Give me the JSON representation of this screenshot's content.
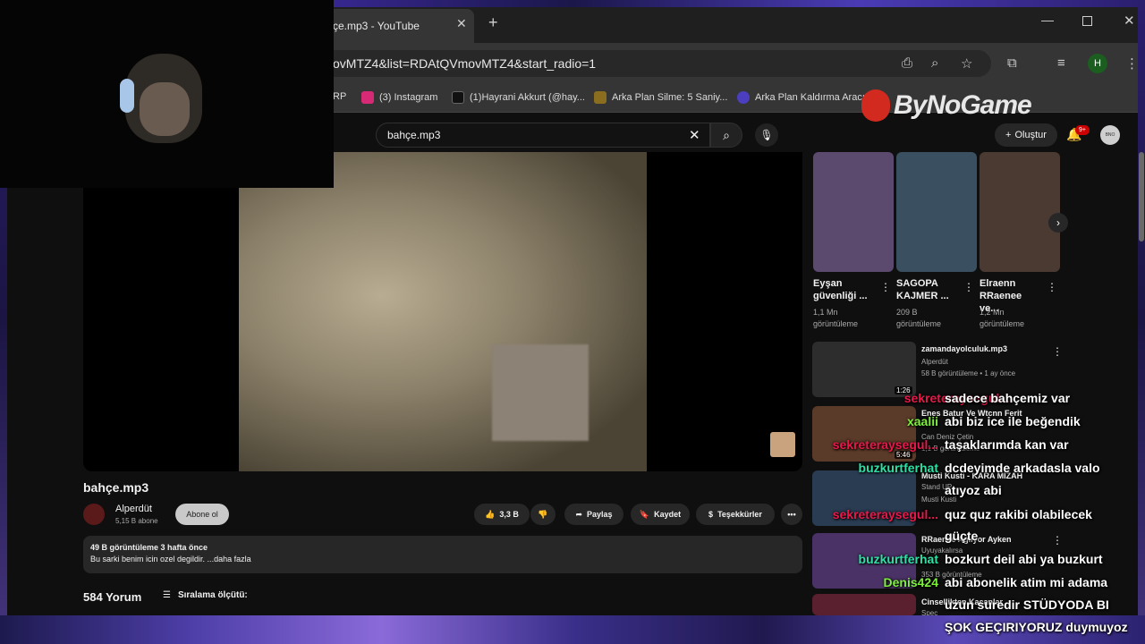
{
  "browser": {
    "tab_title": "çe.mp3 - YouTube",
    "url": "ovMTZ4&list=RDAtQVmovMTZ4&start_radio=1",
    "bookmarks": [
      {
        "label": "RP",
        "color": "#444444"
      },
      {
        "label": "(3) Instagram",
        "color": "#d62976"
      },
      {
        "label": "(1)Hayrani Akkurt (@hay...",
        "color": "#111111"
      },
      {
        "label": "Arka Plan Silme: 5 Saniy...",
        "color": "#8a6d1e"
      },
      {
        "label": "Arka Plan Kaldırma Aracı...",
        "color": "#4b3fbf"
      }
    ],
    "profile_initial": "H"
  },
  "overlay": {
    "logo_text": "ByNoGame"
  },
  "youtube": {
    "search_value": "bahçe.mp3",
    "create_label": "Oluştur",
    "notification_count": "9+",
    "channel_avatar_text": "BNO"
  },
  "video": {
    "title": "bahçe.mp3",
    "channel_name": "Alperdüt",
    "subscribers": "5,15 B abone",
    "subscribe_label": "Abone ol",
    "likes": "3,3 B",
    "share_label": "Paylaş",
    "save_label": "Kaydet",
    "thanks_label": "Teşekkürler",
    "more_label": "•••",
    "stats": "49 B görüntüleme  3 hafta önce",
    "description": "Bu sarki benim icin ozel degildir. ...daha fazla",
    "comment_count": "584 Yorum",
    "sort_label": "Sıralama ölçütü:"
  },
  "shorts": [
    {
      "title": "Eyşan güvenliği ...",
      "views": "1,1 Mn görüntüleme",
      "color": "#5b4a6e"
    },
    {
      "title": "SAGOPA KAJMER ...",
      "views": "209 B görüntüleme",
      "color": "#3a4f60"
    },
    {
      "title": "Elraenn RRaenee ve...",
      "views": "1,2 Mn görüntüleme",
      "color": "#4a3a32"
    }
  ],
  "recommendations": [
    {
      "title": "zamandayolculuk.mp3",
      "channel": "Alperdüt",
      "meta": "58 B görüntüleme • 1 ay önce",
      "duration": "1:26",
      "color": "#2d2d2d"
    },
    {
      "title": "Enes Batur Ve Wtcnn Ferit",
      "channel": "Can Deniz Çetin",
      "meta": "1,1 B görüntüleme",
      "duration": "5:46",
      "color": "#5a3a28"
    },
    {
      "title": "Musti Kusti - KARA MİZAH",
      "channel": "Stand UP",
      "meta": "Musti Kusti",
      "duration": "",
      "color": "#2a3c52"
    },
    {
      "title": "RRaenee Ağlıyor Ayken",
      "channel": "Uyuyakalırsa",
      "meta": "353 B görüntüleme",
      "duration": "",
      "color": "#4a3266"
    },
    {
      "title": "Cinsellikten Kaçanlar",
      "channel": "Spec",
      "meta": "",
      "duration": "",
      "color": "#5a2030"
    }
  ],
  "chat": [
    {
      "user": "sekreteraysegul...",
      "message": "sadece bahçemiz var",
      "color": "#e8194a"
    },
    {
      "user": "xaalii",
      "message": "abi biz ice ile beğendik",
      "color": "#7df03c"
    },
    {
      "user": "sekreteraysegul...",
      "message": "taşaklarımda kan var",
      "color": "#e8194a"
    },
    {
      "user": "buzkurtferhat",
      "message": "dcdeyimde arkadasla valo",
      "color": "#2fe0a6"
    },
    {
      "user": "",
      "message": "atıyoz abi",
      "color": "#ffffff"
    },
    {
      "user": "sekreteraysegul...",
      "message": "quz quz rakibi olabilecek",
      "color": "#e8194a"
    },
    {
      "user": "",
      "message": "güçte",
      "color": "#ffffff"
    },
    {
      "user": "buzkurtferhat",
      "message": "bozkurt deil abi ya buzkurt",
      "color": "#2fe0a6"
    },
    {
      "user": "Denis424",
      "message": "abi abonelik atim mi adama",
      "color": "#7df03c"
    },
    {
      "user": "",
      "message": "uzun suredir STÜDYODA BI",
      "color": "#ffffff"
    },
    {
      "user": "",
      "message": "ŞOK GEÇIRIYORUZ duymuyoz",
      "color": "#ffffff"
    }
  ]
}
